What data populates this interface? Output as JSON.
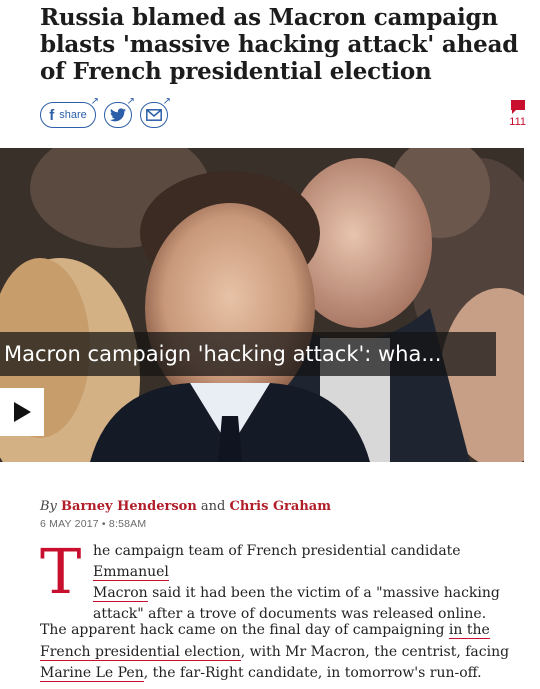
{
  "article": {
    "headline": "Russia blamed as Macron campaign blasts 'massive hacking attack' ahead of French presidential election",
    "comment_count": "111"
  },
  "share": {
    "facebook_icon": "f",
    "facebook_label": "share",
    "icons": [
      "facebook-icon",
      "twitter-icon",
      "email-icon",
      "comment-icon"
    ]
  },
  "video": {
    "title": "Macron campaign 'hacking attack': wha..."
  },
  "byline": {
    "by": "By",
    "author1": "Barney Henderson",
    "and": "and",
    "author2": "Chris Graham",
    "date": "6 MAY 2017 • 8:58AM"
  },
  "body": {
    "dropcap": "T",
    "p1_line1_a": "he campaign team of French presidential candidate ",
    "p1_link1a": "Emmanuel",
    "p1_link1b": "Macron",
    "p1_line2_rest": " said it had been the victim of a \"massive hacking",
    "p1_line3": "attack\" after a trove of documents was released online.",
    "p2_a": "The apparent hack came on the final day of campaigning ",
    "p2_link1": "in the French presidential election",
    "p2_b": ", with Mr Macron, the centrist, facing ",
    "p2_link2": "Marine Le Pen",
    "p2_c": ", the far-Right candidate, in tomorrow's run-off."
  },
  "colors": {
    "accent": "#c8102e",
    "share_blue": "#2c5fa8"
  }
}
